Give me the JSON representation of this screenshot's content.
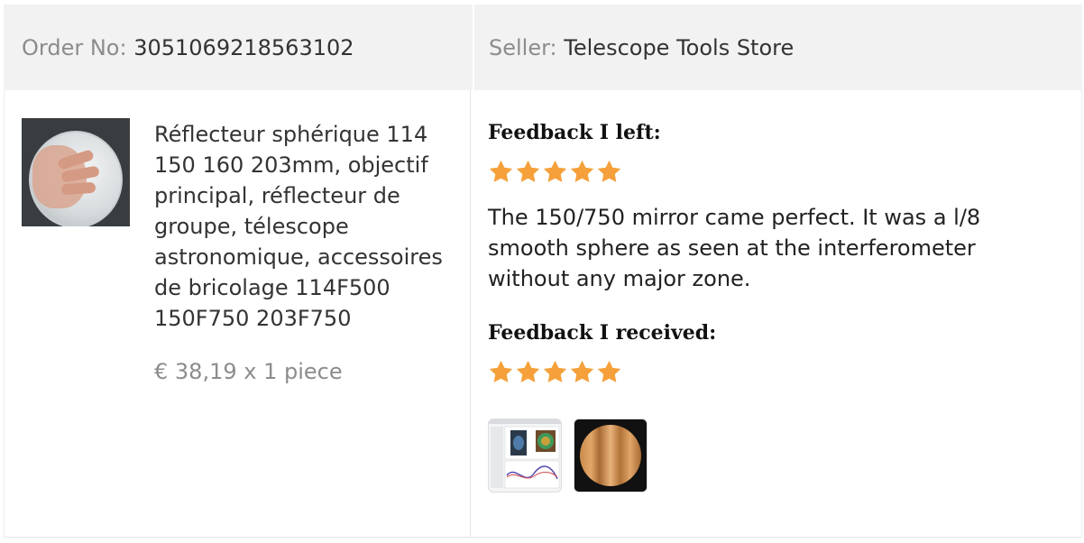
{
  "header": {
    "order_label": "Order No:",
    "order_number": "3051069218563102",
    "seller_label": "Seller:",
    "seller_name": "Telescope Tools Store"
  },
  "product": {
    "image_icon": "mirror-product-photo",
    "title": "Réflecteur sphérique 114 150 160 203mm, objectif principal, réflecteur de groupe, télescope astronomique, accessoires de bricolage 114F500 150F750 203F750",
    "price": "€ 38,19 x 1 piece"
  },
  "feedback": {
    "left_heading": "Feedback I left:",
    "left_rating": 5,
    "left_text": "The 150/750 mirror came perfect. It was a l/8 smooth sphere as seen at the interferometer without any major zone.",
    "received_heading": "Feedback I received:",
    "received_rating": 5,
    "photos": [
      "interferometer-software-screenshot",
      "mirror-interferogram-photo"
    ],
    "star_color": "#f5a03a"
  },
  "colors": {
    "header_bg": "#f2f2f2",
    "muted_text": "#8c8c8c",
    "main_text": "#333333"
  }
}
